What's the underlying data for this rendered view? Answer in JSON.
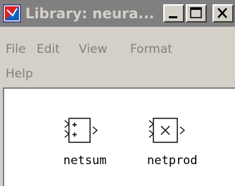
{
  "window": {
    "title": "Library: neura...",
    "minimize_icon": "minimize-icon",
    "maximize_icon": "maximize-icon",
    "close_icon": "close-icon"
  },
  "menu": {
    "items": [
      "File",
      "Edit",
      "View",
      "Format",
      "Help"
    ]
  },
  "library": {
    "blocks": [
      {
        "label": "netsum",
        "symbol": "plus-plus"
      },
      {
        "label": "netprod",
        "symbol": "times"
      }
    ]
  }
}
